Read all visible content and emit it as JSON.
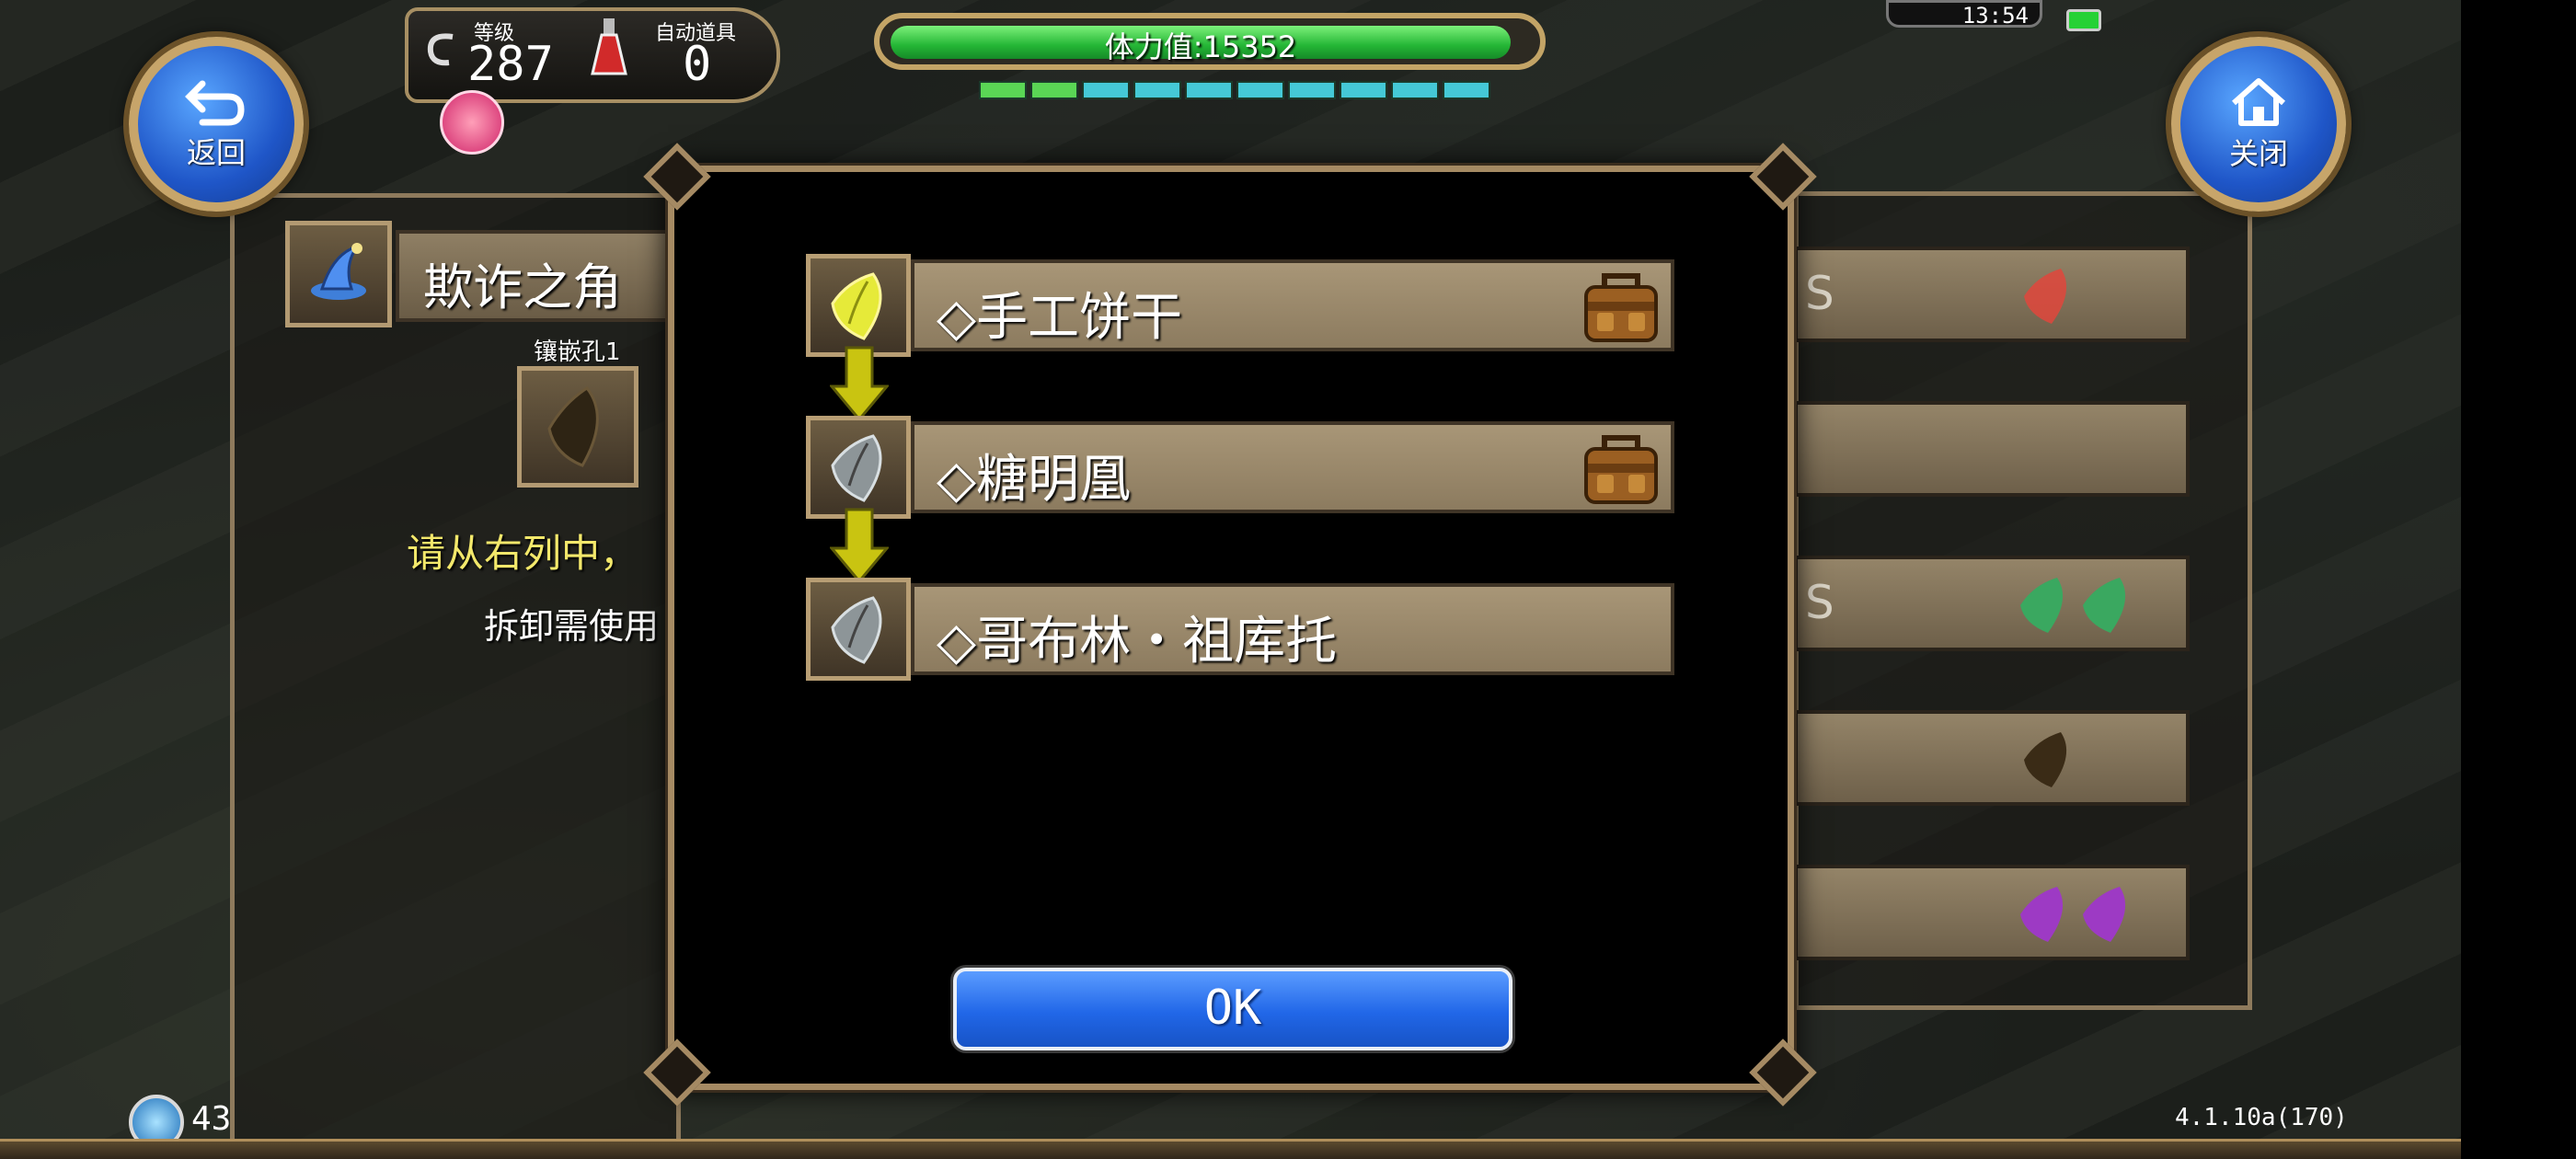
{
  "hud": {
    "back_label": "返回",
    "close_label": "关闭",
    "level_label": "等级",
    "level_value": "287",
    "auto_item_label": "自动道具",
    "auto_item_value": "0",
    "stamina_text": "体力值:15352",
    "clock_text": "13:54"
  },
  "left_panel": {
    "title": "欺诈之角",
    "slot_label": "镶嵌孔1",
    "instruction": "请从右列中，",
    "subtext": "拆卸需使用"
  },
  "right_panel": {
    "rows": [
      {
        "text": "S",
        "gems": [
          "red"
        ]
      },
      {
        "text": "",
        "gems": []
      },
      {
        "text": "S",
        "gems": [
          "green",
          "green"
        ]
      },
      {
        "text": "",
        "gems": [
          "brown"
        ]
      },
      {
        "text": "",
        "gems": [
          "purple",
          "purple"
        ]
      }
    ]
  },
  "dialog": {
    "items": [
      {
        "name": "◇手工饼干",
        "gem": "yellow",
        "has_bag": true
      },
      {
        "name": "◇糖明凰",
        "gem": "gray",
        "has_bag": true
      },
      {
        "name": "◇哥布林・祖库托",
        "gem": "gray",
        "has_bag": false
      }
    ],
    "ok_label": "OK"
  },
  "footer": {
    "count": "43",
    "version": "4.1.10a(170)"
  },
  "colors": {
    "gem_yellow": "#e6ea39",
    "gem_gray": "#8d9598",
    "gem_red": "#e0463c",
    "gem_green": "#3aa860",
    "gem_brown": "#3a2b16",
    "gem_purple": "#9d3ac4",
    "accent_blue": "#2167e8",
    "stamina_green": "#24b635"
  }
}
